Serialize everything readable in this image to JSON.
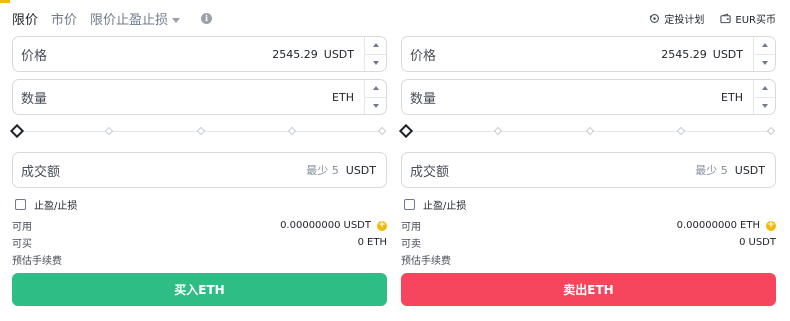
{
  "colors": {
    "buy": "#2ebd85",
    "sell": "#f6465d",
    "accent": "#f0b90b",
    "text": "#1e2329",
    "muted": "#707a8a"
  },
  "order_types": [
    {
      "label": "限价",
      "active": true
    },
    {
      "label": "市价",
      "active": false
    },
    {
      "label": "限价止盈止损",
      "active": false,
      "dropdown": true
    }
  ],
  "info_icon": "i",
  "top_links": {
    "plan": "定投计划",
    "buy_eur": "EUR买币"
  },
  "icons": {
    "plan": "recurring-plan-icon",
    "buy_eur": "wallet-icon",
    "info": "info-icon",
    "plus": "plus-circle-icon"
  },
  "buy": {
    "price": {
      "label": "价格",
      "value": "2545.29",
      "unit": "USDT"
    },
    "amount": {
      "label": "数量",
      "value": "",
      "unit": "ETH"
    },
    "total": {
      "label": "成交额",
      "min": "最少 5",
      "unit": "USDT"
    },
    "slider_percent": 0,
    "tpsl_label": "止盈/止损",
    "available": {
      "label": "可用",
      "value": "0.00000000",
      "unit": "USDT"
    },
    "max": {
      "label": "可买",
      "value": "0",
      "unit": "ETH"
    },
    "fee": {
      "label": "预估手续费"
    },
    "button": "买入ETH"
  },
  "sell": {
    "price": {
      "label": "价格",
      "value": "2545.29",
      "unit": "USDT"
    },
    "amount": {
      "label": "数量",
      "value": "",
      "unit": "ETH"
    },
    "total": {
      "label": "成交额",
      "min": "最少 5",
      "unit": "USDT"
    },
    "slider_percent": 0,
    "tpsl_label": "止盈/止损",
    "available": {
      "label": "可用",
      "value": "0.00000000",
      "unit": "ETH"
    },
    "max": {
      "label": "可卖",
      "value": "0",
      "unit": "USDT"
    },
    "fee": {
      "label": "预估手续费"
    },
    "button": "卖出ETH"
  }
}
